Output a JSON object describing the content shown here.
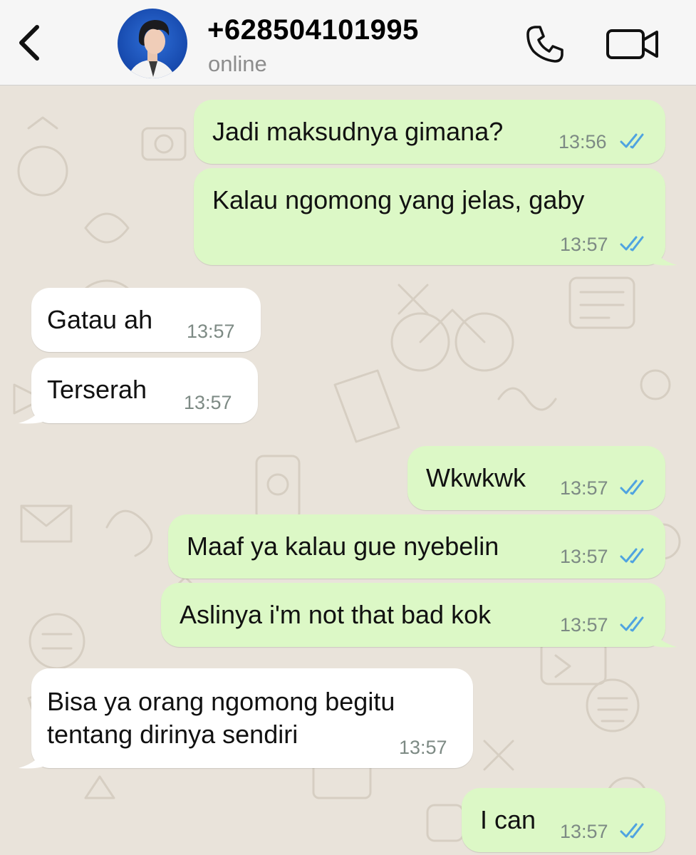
{
  "header": {
    "contact_name": "+628504101995",
    "status": "online",
    "back_icon": "chevron-left-icon",
    "call_icon": "phone-icon",
    "video_icon": "video-camera-icon"
  },
  "colors": {
    "outgoing_bubble": "#dcf8c6",
    "incoming_bubble": "#ffffff",
    "read_ticks": "#4fa3e0",
    "wallpaper": "#e9e3da"
  },
  "messages": [
    {
      "direction": "outgoing",
      "text": "Jadi maksudnya gimana?",
      "time": "13:56",
      "status": "read"
    },
    {
      "direction": "outgoing",
      "text": "Kalau ngomong yang jelas, gaby",
      "time": "13:57",
      "status": "read"
    },
    {
      "direction": "incoming",
      "text": "Gatau ah",
      "time": "13:57"
    },
    {
      "direction": "incoming",
      "text": "Terserah",
      "time": "13:57"
    },
    {
      "direction": "outgoing",
      "text": "Wkwkwk",
      "time": "13:57",
      "status": "read"
    },
    {
      "direction": "outgoing",
      "text": "Maaf ya kalau gue nyebelin",
      "time": "13:57",
      "status": "read"
    },
    {
      "direction": "outgoing",
      "text": "Aslinya i'm not that bad kok",
      "time": "13:57",
      "status": "read"
    },
    {
      "direction": "incoming",
      "text": "Bisa ya orang ngomong begitu tentang dirinya sendiri",
      "time": "13:57"
    },
    {
      "direction": "outgoing",
      "text": "I can",
      "time": "13:57",
      "status": "read"
    }
  ]
}
